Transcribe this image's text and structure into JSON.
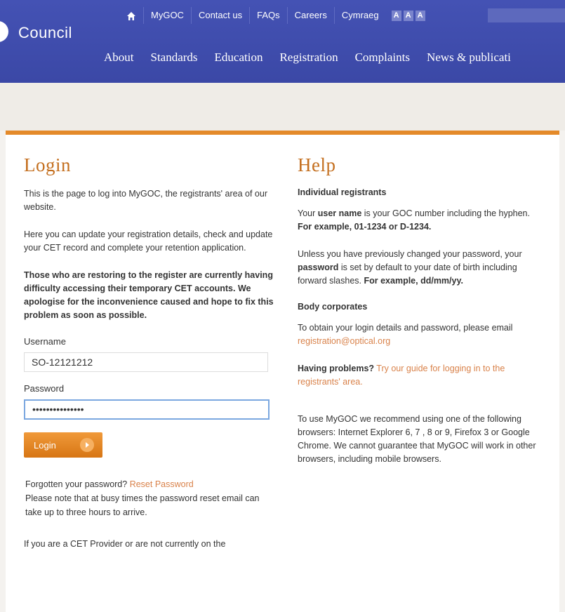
{
  "header": {
    "logo_text": "Council",
    "util_nav": [
      "MyGOC",
      "Contact us",
      "FAQs",
      "Careers",
      "Cymraeg"
    ],
    "text_size": [
      "A",
      "A",
      "A"
    ],
    "main_nav": [
      "About",
      "Standards",
      "Education",
      "Registration",
      "Complaints",
      "News & publicati"
    ]
  },
  "login": {
    "title": "Login",
    "intro1": "This is the page to log into MyGOC, the registrants' area of our website.",
    "intro2": "Here you can update your registration details, check and update your CET record and complete your retention application.",
    "notice": "Those who are restoring to the register are currently having difficulty accessing their temporary CET accounts. We apologise for the inconvenience caused and hope to fix this problem as soon as possible.",
    "username_label": "Username",
    "username_value": "SO-12121212",
    "password_label": "Password",
    "password_value": "•••••••••••••••",
    "login_button": "Login",
    "forgot_text": "Forgotten your password?",
    "reset_link": "Reset Password",
    "reset_note": "Please note that at busy times the password reset email can take up to three hours to arrive.",
    "cet_note": "If you are a CET Provider or are not currently on the"
  },
  "help": {
    "title": "Help",
    "individual_heading": "Individual registrants",
    "p1_a": "Your ",
    "p1_b": "user name",
    "p1_c": " is your GOC number including the hyphen. ",
    "p1_d": "For example, 01-1234 or D-1234.",
    "p2_a": "Unless you have previously changed your password, your ",
    "p2_b": "password",
    "p2_c": " is set by default to your date of birth including forward slashes. ",
    "p2_d": "For example, dd/mm/yy.",
    "body_heading": "Body corporates",
    "p3": "To obtain your login details and password, please email ",
    "email": "registration@optical.org",
    "problems_label": "Having problems?",
    "problems_link": " Try our guide for logging in to the registrants' area.",
    "browsers": "To use MyGOC we recommend using one of the following browsers: Internet Explorer 6, 7 , 8 or 9, Firefox 3 or Google Chrome. We cannot guarantee that MyGOC will work in other browsers, including mobile browsers."
  }
}
